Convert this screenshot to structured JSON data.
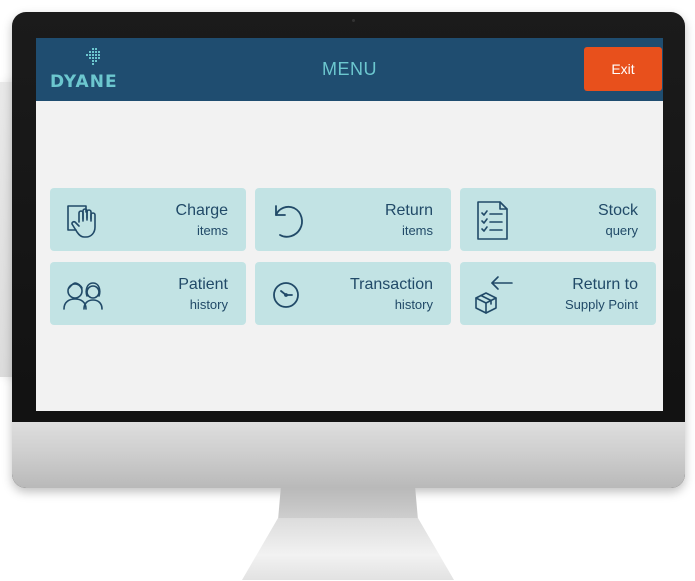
{
  "header": {
    "logo_text": "DYANE",
    "title": "MENU",
    "exit_label": "Exit"
  },
  "menu": {
    "charge": {
      "main": "Charge",
      "sub": "items",
      "icon": "hand-tablet-icon"
    },
    "return": {
      "main": "Return",
      "sub": "items",
      "icon": "undo-arrow-icon"
    },
    "stock": {
      "main": "Stock",
      "sub": "query",
      "icon": "checklist-icon"
    },
    "patient": {
      "main": "Patient",
      "sub": "history",
      "icon": "people-icon"
    },
    "transaction": {
      "main": "Transaction",
      "sub": "history",
      "icon": "clock-icon"
    },
    "supply": {
      "main": "Return to",
      "sub": "Supply Point",
      "icon": "box-arrow-icon"
    }
  },
  "colors": {
    "header_bg": "#1f4d70",
    "accent_teal": "#6cc7cf",
    "tile_bg": "#c2e3e4",
    "tile_text": "#214a68",
    "exit_bg": "#e8501c",
    "screen_bg": "#f2f2f2"
  }
}
